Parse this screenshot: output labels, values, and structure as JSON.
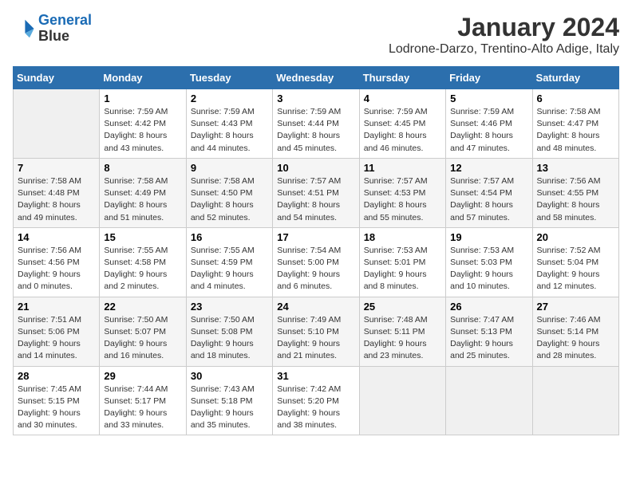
{
  "logo": {
    "line1": "General",
    "line2": "Blue"
  },
  "title": "January 2024",
  "subtitle": "Lodrone-Darzo, Trentino-Alto Adige, Italy",
  "days_of_week": [
    "Sunday",
    "Monday",
    "Tuesday",
    "Wednesday",
    "Thursday",
    "Friday",
    "Saturday"
  ],
  "weeks": [
    [
      {
        "num": "",
        "sunrise": "",
        "sunset": "",
        "daylight": "",
        "empty": true
      },
      {
        "num": "1",
        "sunrise": "7:59 AM",
        "sunset": "4:42 PM",
        "daylight": "8 hours and 43 minutes."
      },
      {
        "num": "2",
        "sunrise": "7:59 AM",
        "sunset": "4:43 PM",
        "daylight": "8 hours and 44 minutes."
      },
      {
        "num": "3",
        "sunrise": "7:59 AM",
        "sunset": "4:44 PM",
        "daylight": "8 hours and 45 minutes."
      },
      {
        "num": "4",
        "sunrise": "7:59 AM",
        "sunset": "4:45 PM",
        "daylight": "8 hours and 46 minutes."
      },
      {
        "num": "5",
        "sunrise": "7:59 AM",
        "sunset": "4:46 PM",
        "daylight": "8 hours and 47 minutes."
      },
      {
        "num": "6",
        "sunrise": "7:58 AM",
        "sunset": "4:47 PM",
        "daylight": "8 hours and 48 minutes."
      }
    ],
    [
      {
        "num": "7",
        "sunrise": "7:58 AM",
        "sunset": "4:48 PM",
        "daylight": "8 hours and 49 minutes."
      },
      {
        "num": "8",
        "sunrise": "7:58 AM",
        "sunset": "4:49 PM",
        "daylight": "8 hours and 51 minutes."
      },
      {
        "num": "9",
        "sunrise": "7:58 AM",
        "sunset": "4:50 PM",
        "daylight": "8 hours and 52 minutes."
      },
      {
        "num": "10",
        "sunrise": "7:57 AM",
        "sunset": "4:51 PM",
        "daylight": "8 hours and 54 minutes."
      },
      {
        "num": "11",
        "sunrise": "7:57 AM",
        "sunset": "4:53 PM",
        "daylight": "8 hours and 55 minutes."
      },
      {
        "num": "12",
        "sunrise": "7:57 AM",
        "sunset": "4:54 PM",
        "daylight": "8 hours and 57 minutes."
      },
      {
        "num": "13",
        "sunrise": "7:56 AM",
        "sunset": "4:55 PM",
        "daylight": "8 hours and 58 minutes."
      }
    ],
    [
      {
        "num": "14",
        "sunrise": "7:56 AM",
        "sunset": "4:56 PM",
        "daylight": "9 hours and 0 minutes."
      },
      {
        "num": "15",
        "sunrise": "7:55 AM",
        "sunset": "4:58 PM",
        "daylight": "9 hours and 2 minutes."
      },
      {
        "num": "16",
        "sunrise": "7:55 AM",
        "sunset": "4:59 PM",
        "daylight": "9 hours and 4 minutes."
      },
      {
        "num": "17",
        "sunrise": "7:54 AM",
        "sunset": "5:00 PM",
        "daylight": "9 hours and 6 minutes."
      },
      {
        "num": "18",
        "sunrise": "7:53 AM",
        "sunset": "5:01 PM",
        "daylight": "9 hours and 8 minutes."
      },
      {
        "num": "19",
        "sunrise": "7:53 AM",
        "sunset": "5:03 PM",
        "daylight": "9 hours and 10 minutes."
      },
      {
        "num": "20",
        "sunrise": "7:52 AM",
        "sunset": "5:04 PM",
        "daylight": "9 hours and 12 minutes."
      }
    ],
    [
      {
        "num": "21",
        "sunrise": "7:51 AM",
        "sunset": "5:06 PM",
        "daylight": "9 hours and 14 minutes."
      },
      {
        "num": "22",
        "sunrise": "7:50 AM",
        "sunset": "5:07 PM",
        "daylight": "9 hours and 16 minutes."
      },
      {
        "num": "23",
        "sunrise": "7:50 AM",
        "sunset": "5:08 PM",
        "daylight": "9 hours and 18 minutes."
      },
      {
        "num": "24",
        "sunrise": "7:49 AM",
        "sunset": "5:10 PM",
        "daylight": "9 hours and 21 minutes."
      },
      {
        "num": "25",
        "sunrise": "7:48 AM",
        "sunset": "5:11 PM",
        "daylight": "9 hours and 23 minutes."
      },
      {
        "num": "26",
        "sunrise": "7:47 AM",
        "sunset": "5:13 PM",
        "daylight": "9 hours and 25 minutes."
      },
      {
        "num": "27",
        "sunrise": "7:46 AM",
        "sunset": "5:14 PM",
        "daylight": "9 hours and 28 minutes."
      }
    ],
    [
      {
        "num": "28",
        "sunrise": "7:45 AM",
        "sunset": "5:15 PM",
        "daylight": "9 hours and 30 minutes."
      },
      {
        "num": "29",
        "sunrise": "7:44 AM",
        "sunset": "5:17 PM",
        "daylight": "9 hours and 33 minutes."
      },
      {
        "num": "30",
        "sunrise": "7:43 AM",
        "sunset": "5:18 PM",
        "daylight": "9 hours and 35 minutes."
      },
      {
        "num": "31",
        "sunrise": "7:42 AM",
        "sunset": "5:20 PM",
        "daylight": "9 hours and 38 minutes."
      },
      {
        "num": "",
        "sunrise": "",
        "sunset": "",
        "daylight": "",
        "empty": true
      },
      {
        "num": "",
        "sunrise": "",
        "sunset": "",
        "daylight": "",
        "empty": true
      },
      {
        "num": "",
        "sunrise": "",
        "sunset": "",
        "daylight": "",
        "empty": true
      }
    ]
  ]
}
